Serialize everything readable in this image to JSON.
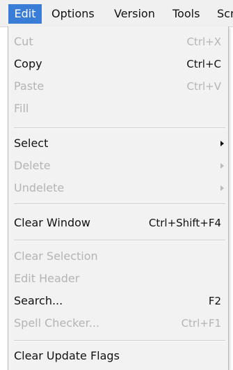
{
  "menubar": {
    "items": [
      {
        "label": "Edit"
      },
      {
        "label": "Options"
      },
      {
        "label": "Version"
      },
      {
        "label": "Tools"
      },
      {
        "label": "Scr"
      }
    ],
    "active_color": "#3a7dd6"
  },
  "edit_menu": {
    "items": [
      {
        "label": "Cut",
        "shortcut": "Ctrl+X",
        "enabled": false
      },
      {
        "label": "Copy",
        "shortcut": "Ctrl+C",
        "enabled": true
      },
      {
        "label": "Paste",
        "shortcut": "Ctrl+V",
        "enabled": false
      },
      {
        "label": "Fill",
        "shortcut": "",
        "enabled": false
      },
      {
        "label": "Select",
        "submenu": true,
        "enabled": true
      },
      {
        "label": "Delete",
        "submenu": true,
        "enabled": false
      },
      {
        "label": "Undelete",
        "submenu": true,
        "enabled": false
      },
      {
        "label": "Clear Window",
        "shortcut": "Ctrl+Shift+F4",
        "enabled": true
      },
      {
        "label": "Clear Selection",
        "shortcut": "",
        "enabled": false
      },
      {
        "label": "Edit Header",
        "shortcut": "",
        "enabled": false
      },
      {
        "label": "Search...",
        "shortcut": "F2",
        "enabled": true
      },
      {
        "label": "Spell Checker...",
        "shortcut": "Ctrl+F1",
        "enabled": false
      },
      {
        "label": "Clear Update Flags",
        "shortcut": "",
        "enabled": true
      }
    ],
    "disabled_color": "#b4b4b4"
  },
  "icons": {
    "submenu_arrow": "chevron-right-icon"
  }
}
